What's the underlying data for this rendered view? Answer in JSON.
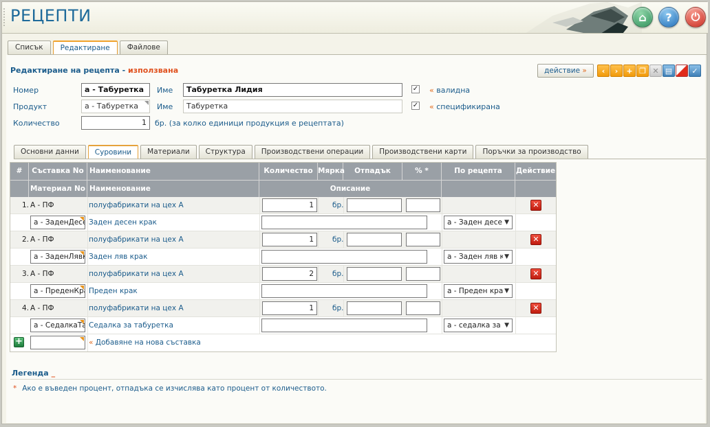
{
  "app": {
    "title": "РЕЦЕПТИ"
  },
  "top_tabs": [
    "Списък",
    "Редактиране",
    "Файлове"
  ],
  "section": {
    "title": "Редактиране на рецепта",
    "separator": " - ",
    "status": "използвана"
  },
  "toolbar": {
    "action_label": "действие",
    "action_chevron": "»"
  },
  "form": {
    "number_label": "Номер",
    "number_value": "а - Табуретка",
    "name_label": "Име",
    "name_value": "Табуретка Лидия",
    "valid_chev": "«",
    "valid_label": "валидна",
    "product_label": "Продукт",
    "product_value": "а - Табуретка",
    "product_name_label": "Име",
    "product_name_value": "Табуретка",
    "specified_chev": "«",
    "specified_label": "спецификирана",
    "quantity_label": "Количество",
    "quantity_value": "1",
    "quantity_unit_note": "бр. (за колко единици продукция е рецептата)"
  },
  "inner_tabs": [
    "Основни данни",
    "Суровини",
    "Материали",
    "Структура",
    "Производствени операции",
    "Производствени карти",
    "Поръчки за производство"
  ],
  "table": {
    "header1": {
      "num": "#",
      "comp_no": "Съставка No",
      "name": "Наименование",
      "qty": "Количество",
      "unit": "Мярка",
      "waste": "Отпадък",
      "pct": "% *",
      "by_recipe": "По рецепта",
      "action": "Действие"
    },
    "header2": {
      "material_no": "Материал No",
      "name": "Наименование",
      "description": "Описание"
    },
    "rows": [
      {
        "num": "1.",
        "comp": "А - ПФ",
        "comp_name": "полуфабрикати на цех А",
        "qty": "1",
        "unit": "бр.",
        "material": "а - ЗаденДесе",
        "material_name": "Заден десен крак",
        "recipe": "а - Заден десе"
      },
      {
        "num": "2.",
        "comp": "А - ПФ",
        "comp_name": "полуфабрикати на цех А",
        "qty": "1",
        "unit": "бр.",
        "material": "а - ЗаденЛявК",
        "material_name": "Заден ляв крак",
        "recipe": "а - Заден ляв к"
      },
      {
        "num": "3.",
        "comp": "А - ПФ",
        "comp_name": "полуфабрикати на цех А",
        "qty": "2",
        "unit": "бр.",
        "material": "а - ПреденКра",
        "material_name": "Преден крак",
        "recipe": "а - Преден кра"
      },
      {
        "num": "4.",
        "comp": "А - ПФ",
        "comp_name": "полуфабрикати на цех А",
        "qty": "1",
        "unit": "бр.",
        "material": "а - СедалкаТа",
        "material_name": "Седалка за табуретка",
        "recipe": "а - седалка за т"
      }
    ],
    "add_chev": "«",
    "add_label": "Добавяне на нова съставка"
  },
  "legend": {
    "title": "Легенда",
    "underscore": "_",
    "asterisk": "*",
    "note": "Ако е въведен процент, отпадъка се изчислява като процент от количеството."
  },
  "icons": {
    "header": [
      "home-icon",
      "help-icon",
      "power-icon"
    ],
    "toolbar": [
      "prev-icon",
      "next-icon",
      "add-icon",
      "copy-icon",
      "close-icon",
      "print-icon",
      "clear-icon",
      "confirm-icon"
    ]
  },
  "colors": {
    "accent": "#1e6a9a",
    "status": "#e0501d",
    "tab_active": "#f0a22b"
  }
}
